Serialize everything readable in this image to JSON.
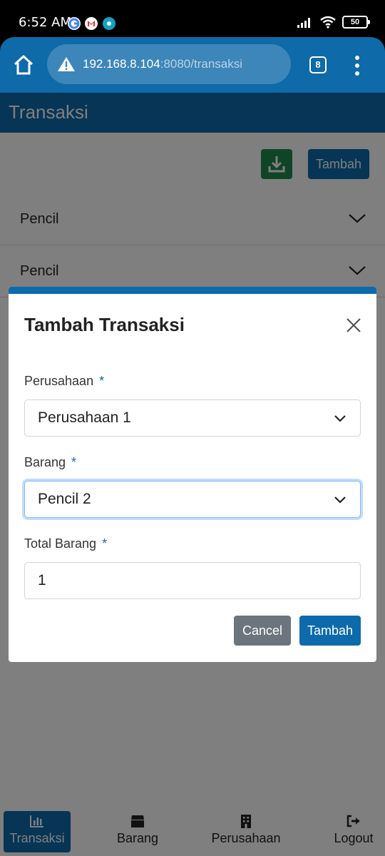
{
  "status_bar": {
    "time": "6:52 AM",
    "app_icons": [
      "google-icon",
      "gmail-icon",
      "blu-app-icon"
    ],
    "battery": "50"
  },
  "browser": {
    "url_host": "192.168.8.104",
    "url_rest": ":8080/transaksi",
    "tab_count": "8"
  },
  "page": {
    "title": "Transaksi",
    "add_button": "Tambah",
    "list": [
      {
        "label": "Pencil"
      },
      {
        "label": "Pencil"
      }
    ]
  },
  "bottom_nav": {
    "items": [
      {
        "label": "Transaksi",
        "icon": "chart-icon"
      },
      {
        "label": "Barang",
        "icon": "box-icon"
      },
      {
        "label": "Perusahaan",
        "icon": "building-icon"
      },
      {
        "label": "Logout",
        "icon": "logout-icon"
      }
    ]
  },
  "modal": {
    "title": "Tambah Transaksi",
    "perusahaan_label": "Perusahaan",
    "perusahaan_value": "Perusahaan 1",
    "barang_label": "Barang",
    "barang_value": "Pencil 2",
    "total_label": "Total Barang",
    "total_value": "1",
    "required_mark": "*",
    "cancel": "Cancel",
    "submit": "Tambah"
  },
  "colors": {
    "primary": "#0d6aab",
    "success": "#1f8a4c",
    "secondary": "#6c757d"
  }
}
